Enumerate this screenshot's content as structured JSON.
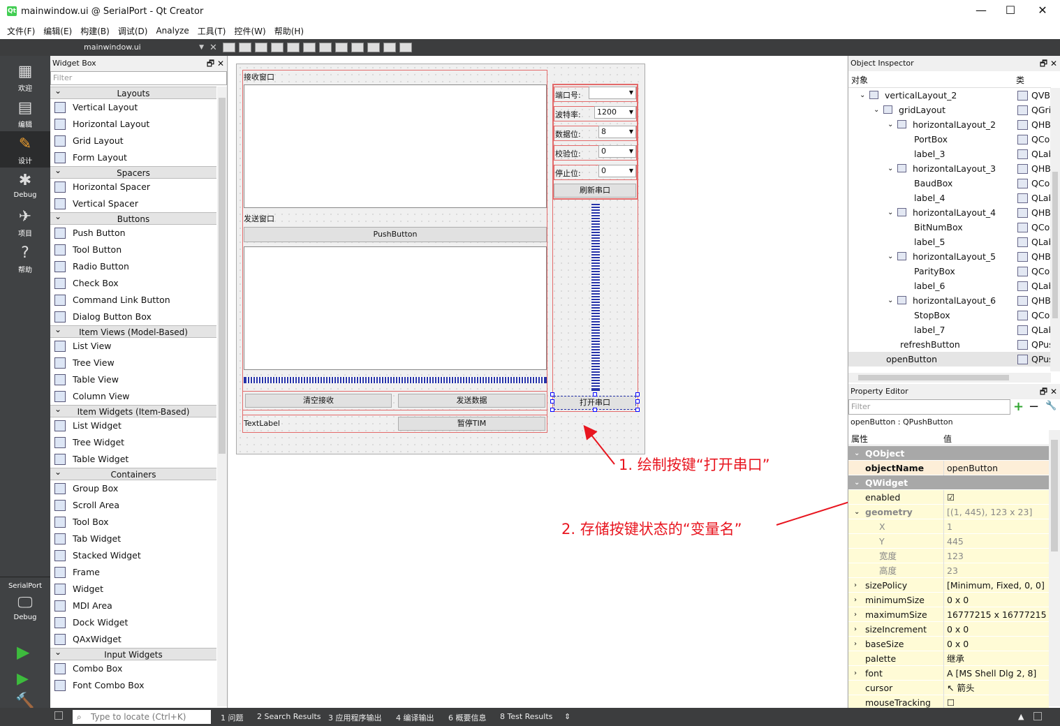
{
  "window": {
    "title": "mainwindow.ui @ SerialPort - Qt Creator",
    "minimize": "—",
    "maximize": "☐",
    "close": "✕"
  },
  "menu": [
    "文件(F)",
    "编辑(E)",
    "构建(B)",
    "调试(D)",
    "Analyze",
    "工具(T)",
    "控件(W)",
    "帮助(H)"
  ],
  "toolbar": {
    "file": "mainwindow.ui"
  },
  "modes": [
    {
      "label": "欢迎",
      "icon": "▦"
    },
    {
      "label": "编辑",
      "icon": "▤"
    },
    {
      "label": "设计",
      "icon": "✎"
    },
    {
      "label": "Debug",
      "icon": "✱"
    },
    {
      "label": "项目",
      "icon": "✈"
    },
    {
      "label": "帮助",
      "icon": "?"
    }
  ],
  "kit": {
    "project": "SerialPort",
    "build": "Debug"
  },
  "widget_box": {
    "title": "Widget Box",
    "filter_placeholder": "Filter",
    "groups": [
      {
        "name": "Layouts",
        "items": [
          "Vertical Layout",
          "Horizontal Layout",
          "Grid Layout",
          "Form Layout"
        ]
      },
      {
        "name": "Spacers",
        "items": [
          "Horizontal Spacer",
          "Vertical Spacer"
        ]
      },
      {
        "name": "Buttons",
        "items": [
          "Push Button",
          "Tool Button",
          "Radio Button",
          "Check Box",
          "Command Link Button",
          "Dialog Button Box"
        ]
      },
      {
        "name": "Item Views (Model-Based)",
        "items": [
          "List View",
          "Tree View",
          "Table View",
          "Column View"
        ]
      },
      {
        "name": "Item Widgets (Item-Based)",
        "items": [
          "List Widget",
          "Tree Widget",
          "Table Widget"
        ]
      },
      {
        "name": "Containers",
        "items": [
          "Group Box",
          "Scroll Area",
          "Tool Box",
          "Tab Widget",
          "Stacked Widget",
          "Frame",
          "Widget",
          "MDI Area",
          "Dock Widget",
          "QAxWidget"
        ]
      },
      {
        "name": "Input Widgets",
        "items": [
          "Combo Box",
          "Font Combo Box"
        ]
      }
    ]
  },
  "form": {
    "recv_label": "接收窗口",
    "send_label": "发送窗口",
    "push_button": "PushButton",
    "clear_button": "清空接收",
    "send_button": "发送数据",
    "text_label": "TextLabel",
    "tim_button": "暂停TIM",
    "port_label": "端口号:",
    "port_value": "",
    "baud_label": "波特率:",
    "baud_value": "1200",
    "bits_label": "数据位:",
    "bits_value": "8",
    "parity_label": "校验位:",
    "parity_value": "0",
    "stop_label": "停止位:",
    "stop_value": "0",
    "refresh_button": "刷新串口",
    "open_button": "打开串口"
  },
  "annotations": {
    "a1": "1. 绘制按键“打开串口”",
    "a2": "2. 存储按键状态的“变量名”"
  },
  "object_inspector": {
    "title": "Object Inspector",
    "col_object": "对象",
    "col_class": "类",
    "rows": [
      {
        "name": "verticalLayout_2",
        "cls": "QVBoxLayout",
        "indent": 1,
        "expand": true
      },
      {
        "name": "gridLayout",
        "cls": "QGridLayout",
        "indent": 2,
        "expand": true
      },
      {
        "name": "horizontalLayout_2",
        "cls": "QHBoxLayout",
        "indent": 3,
        "expand": true
      },
      {
        "name": "PortBox",
        "cls": "QComboBox",
        "indent": 4
      },
      {
        "name": "label_3",
        "cls": "QLabel",
        "indent": 4
      },
      {
        "name": "horizontalLayout_3",
        "cls": "QHBoxLayout",
        "indent": 3,
        "expand": true
      },
      {
        "name": "BaudBox",
        "cls": "QComboBox",
        "indent": 4
      },
      {
        "name": "label_4",
        "cls": "QLabel",
        "indent": 4
      },
      {
        "name": "horizontalLayout_4",
        "cls": "QHBoxLayout",
        "indent": 3,
        "expand": true
      },
      {
        "name": "BitNumBox",
        "cls": "QComboBox",
        "indent": 4
      },
      {
        "name": "label_5",
        "cls": "QLabel",
        "indent": 4
      },
      {
        "name": "horizontalLayout_5",
        "cls": "QHBoxLayout",
        "indent": 3,
        "expand": true
      },
      {
        "name": "ParityBox",
        "cls": "QComboBox",
        "indent": 4
      },
      {
        "name": "label_6",
        "cls": "QLabel",
        "indent": 4
      },
      {
        "name": "horizontalLayout_6",
        "cls": "QHBoxLayout",
        "indent": 3,
        "expand": true
      },
      {
        "name": "StopBox",
        "cls": "QComboBox",
        "indent": 4
      },
      {
        "name": "label_7",
        "cls": "QLabel",
        "indent": 4
      },
      {
        "name": "refreshButton",
        "cls": "QPushButton",
        "indent": 3
      },
      {
        "name": "openButton",
        "cls": "QPushButton",
        "indent": 2,
        "selected": true
      }
    ]
  },
  "property_editor": {
    "title": "Property Editor",
    "filter_placeholder": "Filter",
    "object": "openButton : QPushButton",
    "col_prop": "属性",
    "col_value": "值",
    "rows": [
      {
        "k": "QObject",
        "v": "",
        "type": "grp"
      },
      {
        "k": "objectName",
        "v": "openButton",
        "type": "obj"
      },
      {
        "k": "QWidget",
        "v": "",
        "type": "grp"
      },
      {
        "k": "enabled",
        "v": "☑",
        "type": "norm"
      },
      {
        "k": "geometry",
        "v": "[(1, 445), 123 x 23]",
        "type": "geo"
      },
      {
        "k": "X",
        "v": "1",
        "type": "sub"
      },
      {
        "k": "Y",
        "v": "445",
        "type": "sub"
      },
      {
        "k": "宽度",
        "v": "123",
        "type": "sub"
      },
      {
        "k": "高度",
        "v": "23",
        "type": "sub"
      },
      {
        "k": "sizePolicy",
        "v": "[Minimum, Fixed, 0, 0]",
        "type": "norm"
      },
      {
        "k": "minimumSize",
        "v": "0 x 0",
        "type": "norm"
      },
      {
        "k": "maximumSize",
        "v": "16777215 x 16777215",
        "type": "norm"
      },
      {
        "k": "sizeIncrement",
        "v": "0 x 0",
        "type": "norm"
      },
      {
        "k": "baseSize",
        "v": "0 x 0",
        "type": "norm"
      },
      {
        "k": "palette",
        "v": "继承",
        "type": "norm"
      },
      {
        "k": "font",
        "v": "A  [MS Shell Dlg 2, 8]",
        "type": "norm"
      },
      {
        "k": "cursor",
        "v": "↖  箭头",
        "type": "norm"
      },
      {
        "k": "mouseTracking",
        "v": "☐",
        "type": "norm"
      }
    ]
  },
  "statusbar": {
    "locate_placeholder": "Type to locate (Ctrl+K)",
    "tabs": [
      "1  问题",
      "2  Search Results",
      "3  应用程序输出",
      "4  编译输出",
      "6  概要信息",
      "8  Test Results"
    ]
  },
  "colors": {
    "annotation": "#e8151f",
    "dark": "#404244",
    "selection": "#fdeed8"
  }
}
